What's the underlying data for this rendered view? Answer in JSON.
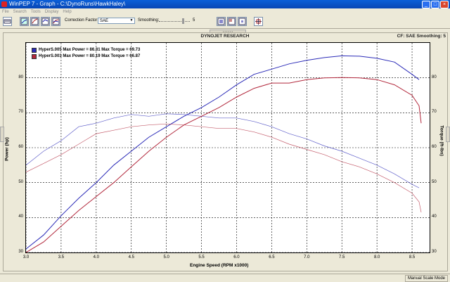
{
  "window": {
    "title": "WinPEP 7 - Graph - C:\\DynoRuns\\HawkHaley\\"
  },
  "menu": [
    "File",
    "Search",
    "Tools",
    "Display",
    "Help"
  ],
  "toolbar": {
    "correction_factor_label": "Correction Factor",
    "correction_factor_value": "SAE",
    "smoothing_label": "Smoothing:",
    "smoothing_value": "5",
    "smoothing_level": 0.8
  },
  "graph": {
    "header_center": "DYNOJET RESEARCH",
    "header_right": "CF: SAE  Smoothing: 5"
  },
  "status": {
    "mode": "Manual Scale Mode"
  },
  "colors": {
    "run1": "#2b2bb8",
    "run2": "#b2283c",
    "grid": "#000000"
  },
  "chart_data": {
    "type": "line",
    "title": "",
    "xlabel": "Engine Speed (RPM x1000)",
    "ylabel": "Power (hp)",
    "y2label": "Torque (ft-lbs)",
    "xlim": [
      3.0,
      8.75
    ],
    "ylim": [
      30,
      90
    ],
    "y2lim": [
      30,
      90
    ],
    "xticks": [
      "3.0",
      "3.5",
      "4.0",
      "4.5",
      "5.0",
      "5.5",
      "6.0",
      "6.5",
      "7.0",
      "7.5",
      "8.0",
      "8.5"
    ],
    "yticks": [
      "30",
      "40",
      "50",
      "60",
      "70",
      "80"
    ],
    "y2ticks": [
      "30",
      "40",
      "50",
      "60",
      "70",
      "80"
    ],
    "grid": true,
    "legend": [
      {
        "label": "HyperS.005 Max Power = 86.31 Max Torque = 69.73",
        "color": "#2b2bb8"
      },
      {
        "label": "HyperS.003 Max Power = 80.19 Max Torque = 66.87",
        "color": "#b2283c"
      }
    ],
    "series": [
      {
        "name": "HyperS.005",
        "kind": "power",
        "color": "#2b2bb8",
        "x": [
          3.0,
          3.25,
          3.5,
          3.75,
          4.0,
          4.25,
          4.5,
          4.75,
          5.0,
          5.25,
          5.5,
          5.75,
          6.0,
          6.25,
          6.5,
          6.75,
          7.0,
          7.25,
          7.5,
          7.75,
          8.0,
          8.25,
          8.5,
          8.6
        ],
        "y": [
          31,
          35,
          40.5,
          45.5,
          50,
          55,
          59,
          63,
          66,
          69,
          71.5,
          74.5,
          78,
          81,
          82.5,
          84,
          85,
          85.8,
          86.3,
          86.2,
          85.6,
          84.5,
          81,
          79.5
        ]
      },
      {
        "name": "HyperS.005",
        "kind": "torque",
        "color": "#2b2bb8",
        "x": [
          3.0,
          3.25,
          3.5,
          3.75,
          4.0,
          4.25,
          4.5,
          4.75,
          5.0,
          5.25,
          5.5,
          5.75,
          6.0,
          6.25,
          6.5,
          6.75,
          7.0,
          7.25,
          7.5,
          7.75,
          8.0,
          8.25,
          8.5,
          8.6
        ],
        "y": [
          55,
          59,
          62,
          66,
          67,
          68.5,
          69.5,
          69,
          69.7,
          69.5,
          69,
          68.5,
          68.5,
          67.5,
          66,
          64,
          62.5,
          60.5,
          59,
          57,
          55,
          52.5,
          49.5,
          48.5
        ]
      },
      {
        "name": "HyperS.003",
        "kind": "power",
        "color": "#b2283c",
        "x": [
          3.0,
          3.25,
          3.5,
          3.75,
          4.0,
          4.25,
          4.5,
          4.75,
          5.0,
          5.25,
          5.5,
          5.75,
          6.0,
          6.25,
          6.5,
          6.75,
          7.0,
          7.25,
          7.5,
          7.75,
          8.0,
          8.25,
          8.5,
          8.6,
          8.63
        ],
        "y": [
          30,
          33,
          37.5,
          42,
          46,
          50,
          54.5,
          59,
          63,
          66.5,
          69,
          71.5,
          74.5,
          77,
          78.5,
          78.5,
          79.5,
          80,
          80.1,
          80,
          79.5,
          78,
          75,
          72,
          67
        ]
      },
      {
        "name": "HyperS.003",
        "kind": "torque",
        "color": "#b2283c",
        "x": [
          3.0,
          3.25,
          3.5,
          3.75,
          4.0,
          4.25,
          4.5,
          4.75,
          5.0,
          5.25,
          5.5,
          5.75,
          6.0,
          6.25,
          6.5,
          6.75,
          7.0,
          7.25,
          7.5,
          7.75,
          8.0,
          8.25,
          8.5,
          8.6,
          8.63
        ],
        "y": [
          53,
          55.5,
          58,
          61,
          64,
          65,
          66,
          66.5,
          66.8,
          66.5,
          66,
          65.5,
          65.5,
          64.5,
          63,
          61,
          59.5,
          58,
          56,
          54.5,
          52.5,
          50,
          47,
          44.5,
          41.5
        ]
      }
    ]
  }
}
